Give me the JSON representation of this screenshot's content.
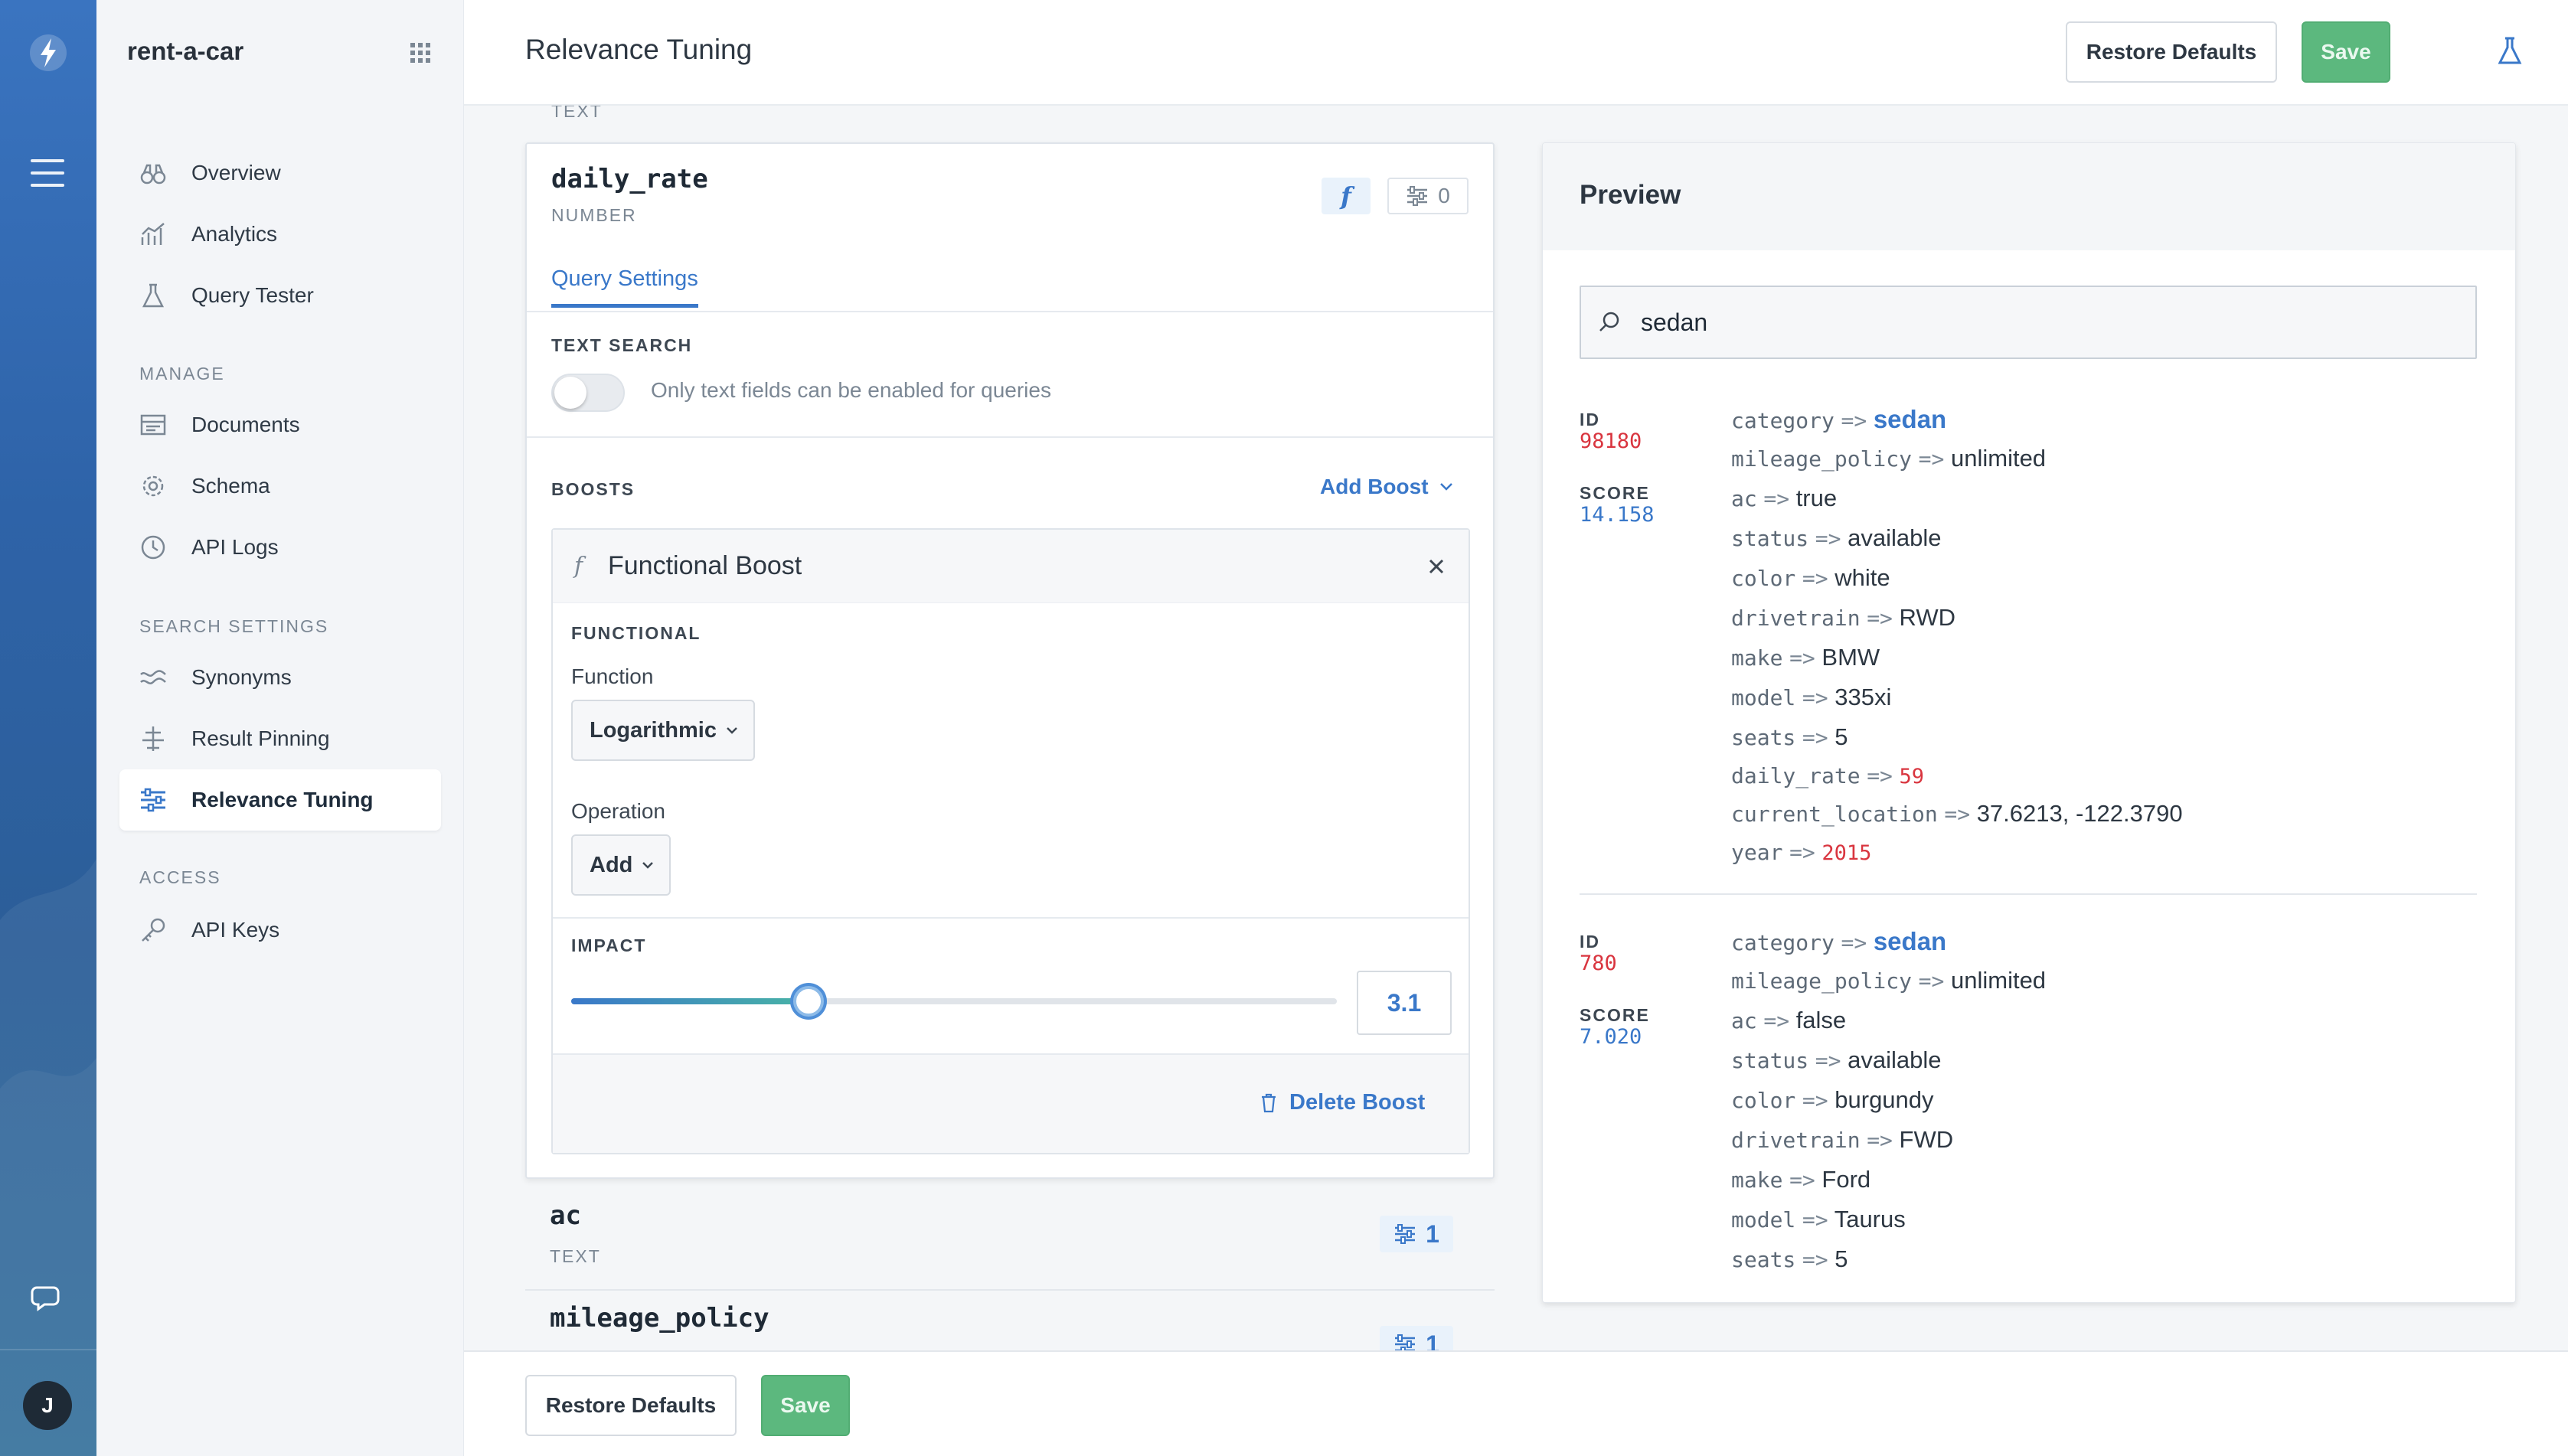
{
  "app": {
    "engine_name": "rent-a-car",
    "user_initial": "J"
  },
  "nav": {
    "items": [
      {
        "label": "Overview"
      },
      {
        "label": "Analytics"
      },
      {
        "label": "Query Tester"
      },
      {
        "label": "Documents"
      },
      {
        "label": "Schema"
      },
      {
        "label": "API Logs"
      },
      {
        "label": "Synonyms"
      },
      {
        "label": "Result Pinning"
      },
      {
        "label": "Relevance Tuning"
      },
      {
        "label": "API Keys"
      }
    ],
    "sections": {
      "manage": "MANAGE",
      "search_settings": "SEARCH SETTINGS",
      "access": "ACCESS"
    },
    "active": "Relevance Tuning"
  },
  "header": {
    "title": "Relevance Tuning",
    "restore_label": "Restore Defaults",
    "save_label": "Save"
  },
  "main": {
    "prev_field_type": "TEXT",
    "field": {
      "name": "daily_rate",
      "type": "NUMBER",
      "function_badge": "f",
      "boost_count": "0",
      "tab": "Query Settings",
      "text_search_label": "TEXT SEARCH",
      "text_search_note": "Only text fields can be enabled for queries",
      "text_search_enabled": false,
      "boosts_label": "BOOSTS",
      "add_boost_label": "Add Boost",
      "boost": {
        "title": "Functional Boost",
        "f_symbol": "f",
        "section_label": "FUNCTIONAL",
        "function_label": "Function",
        "function_value": "Logarithmic",
        "operation_label": "Operation",
        "operation_value": "Add",
        "impact_label": "IMPACT",
        "impact_value": "3.1",
        "impact_fraction": 0.31,
        "delete_label": "Delete Boost"
      }
    },
    "other_fields": [
      {
        "name": "ac",
        "type": "TEXT",
        "count": "1"
      },
      {
        "name": "mileage_policy",
        "type": "",
        "count": "1"
      }
    ]
  },
  "preview": {
    "title": "Preview",
    "query": "sedan",
    "id_label": "ID",
    "score_label": "SCORE",
    "arrow": "=>",
    "results": [
      {
        "id": "98180",
        "score": "14.158",
        "attributes": [
          {
            "key": "category",
            "value": "sedan",
            "style": "link"
          },
          {
            "key": "mileage_policy",
            "value": "unlimited",
            "style": "text"
          },
          {
            "key": "ac",
            "value": "true",
            "style": "text"
          },
          {
            "key": "status",
            "value": "available",
            "style": "text"
          },
          {
            "key": "color",
            "value": "white",
            "style": "text"
          },
          {
            "key": "drivetrain",
            "value": "RWD",
            "style": "text"
          },
          {
            "key": "make",
            "value": "BMW",
            "style": "text"
          },
          {
            "key": "model",
            "value": "335xi",
            "style": "text"
          },
          {
            "key": "seats",
            "value": "5",
            "style": "text"
          },
          {
            "key": "daily_rate",
            "value": "59",
            "style": "num"
          },
          {
            "key": "current_location",
            "value": "37.6213, -122.3790",
            "style": "text"
          },
          {
            "key": "year",
            "value": "2015",
            "style": "num"
          }
        ]
      },
      {
        "id": "780",
        "score": "7.020",
        "attributes": [
          {
            "key": "category",
            "value": "sedan",
            "style": "link"
          },
          {
            "key": "mileage_policy",
            "value": "unlimited",
            "style": "text"
          },
          {
            "key": "ac",
            "value": "false",
            "style": "text"
          },
          {
            "key": "status",
            "value": "available",
            "style": "text"
          },
          {
            "key": "color",
            "value": "burgundy",
            "style": "text"
          },
          {
            "key": "drivetrain",
            "value": "FWD",
            "style": "text"
          },
          {
            "key": "make",
            "value": "Ford",
            "style": "text"
          },
          {
            "key": "model",
            "value": "Taurus",
            "style": "text"
          },
          {
            "key": "seats",
            "value": "5",
            "style": "text"
          }
        ]
      }
    ]
  },
  "footer": {
    "restore_label": "Restore Defaults",
    "save_label": "Save"
  },
  "colors": {
    "accent": "#3a78c9",
    "save_green": "#5cb87e",
    "number_red": "#d9353f",
    "rail_blue": "#2e63a8"
  }
}
